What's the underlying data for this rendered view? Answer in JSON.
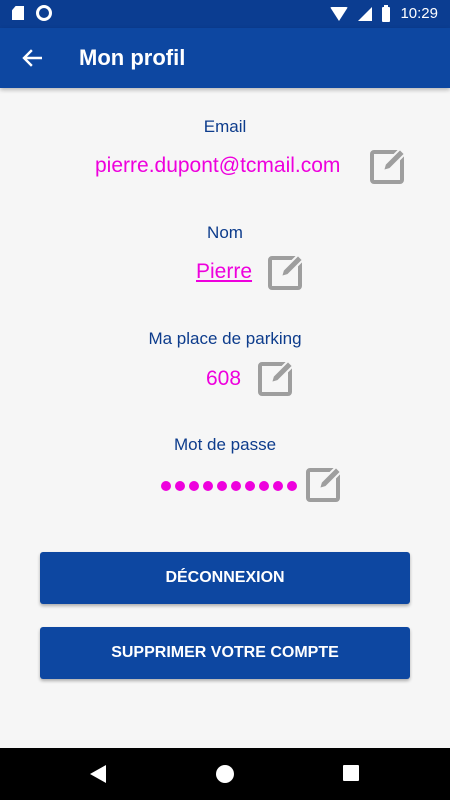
{
  "status_bar": {
    "time": "10:29"
  },
  "app_bar": {
    "title": "Mon profil"
  },
  "profile": {
    "email": {
      "label": "Email",
      "value": "pierre.dupont@tcmail.com"
    },
    "name": {
      "label": "Nom",
      "value": "Pierre"
    },
    "parking": {
      "label": "Ma place de parking",
      "value": "608"
    },
    "password": {
      "label": "Mot de passe",
      "masked_length": 10
    }
  },
  "actions": {
    "logout_label": "DÉCONNEXION",
    "delete_label": "SUPPRIMER VOTRE COMPTE"
  },
  "colors": {
    "primary": "#0d47a1",
    "status_bar": "#0b3d91",
    "label_text": "#0d3c8c",
    "value_text": "#ee00dd",
    "edit_icon": "#9e9e9e"
  }
}
